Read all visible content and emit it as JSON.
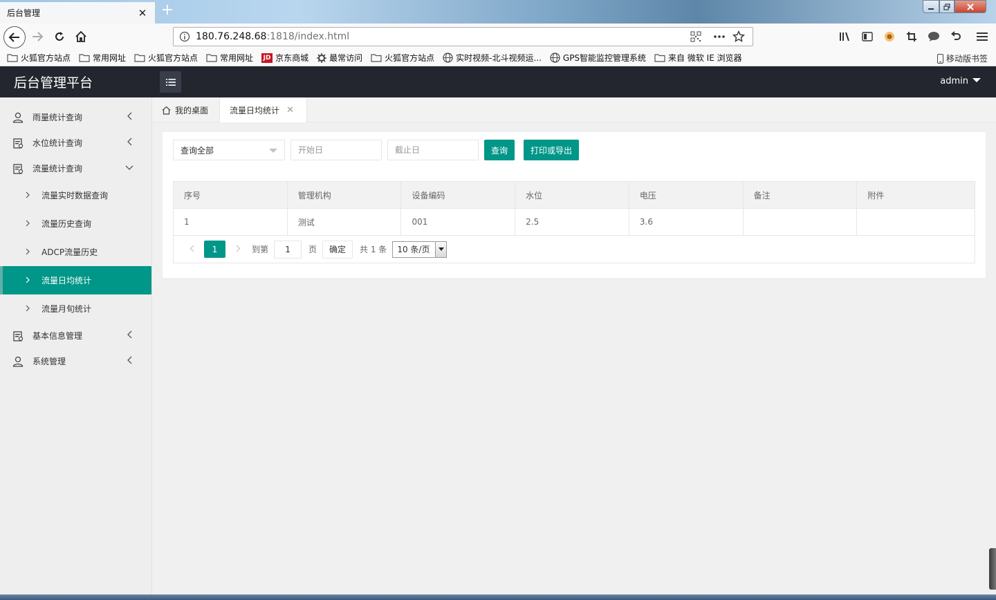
{
  "browser": {
    "tab_title": "后台管理",
    "tab_close": "✕",
    "new_tab": "+",
    "url_host": "180.76.248.68",
    "url_rest": ":1818/index.html",
    "bookmarks": [
      {
        "label": "火狐官方站点",
        "icon": "folder-icon"
      },
      {
        "label": "常用网址",
        "icon": "folder-icon"
      },
      {
        "label": "火狐官方站点",
        "icon": "folder-icon"
      },
      {
        "label": "常用网址",
        "icon": "folder-icon"
      },
      {
        "label": "京东商城",
        "icon": "jd-icon"
      },
      {
        "label": "最常访问",
        "icon": "gear-icon"
      },
      {
        "label": "火狐官方站点",
        "icon": "folder-icon"
      },
      {
        "label": "实时视频-北斗视频运...",
        "icon": "globe-icon"
      },
      {
        "label": "GPS智能监控管理系统",
        "icon": "globe-icon"
      },
      {
        "label": "来自 微软 IE 浏览器",
        "icon": "folder-icon"
      }
    ],
    "mobile_bookmarks": "移动版书签",
    "jd_badge": "JD"
  },
  "app": {
    "title": "后台管理平台",
    "user": "admin"
  },
  "sidebar": {
    "items": [
      {
        "label": "雨量统计查询",
        "icon": "user-icon",
        "expanded": false
      },
      {
        "label": "水位统计查询",
        "icon": "calendar-icon",
        "expanded": false
      },
      {
        "label": "流量统计查询",
        "icon": "calendar-icon",
        "expanded": true,
        "children": [
          {
            "label": "流量实时数据查询"
          },
          {
            "label": "流量历史查询"
          },
          {
            "label": "ADCP流量历史"
          },
          {
            "label": "流量日均统计",
            "active": true
          },
          {
            "label": "流量月旬统计"
          }
        ]
      },
      {
        "label": "基本信息管理",
        "icon": "calendar-icon",
        "expanded": false
      },
      {
        "label": "系统管理",
        "icon": "user-icon",
        "expanded": false
      }
    ]
  },
  "content_tabs": {
    "home": "我的桌面",
    "active": "流量日均统计",
    "close": "✕"
  },
  "filters": {
    "select_value": "查询全部",
    "start_placeholder": "开始日",
    "end_placeholder": "截止日",
    "query_button": "查询",
    "export_button": "打印或导出"
  },
  "table": {
    "columns": [
      "序号",
      "管理机构",
      "设备编码",
      "水位",
      "电压",
      "备注",
      "附件"
    ],
    "rows": [
      [
        "1",
        "测试",
        "001",
        "2.5",
        "3.6",
        "",
        ""
      ]
    ]
  },
  "pagination": {
    "current_page": "1",
    "goto_label": "到第",
    "goto_value": "1",
    "page_unit": "页",
    "confirm": "确定",
    "total": "共 1 条",
    "page_size": "10 条/页"
  },
  "colors": {
    "accent": "#009688",
    "header_bg": "#23262e",
    "sidebar_bg": "#eeeeee"
  }
}
